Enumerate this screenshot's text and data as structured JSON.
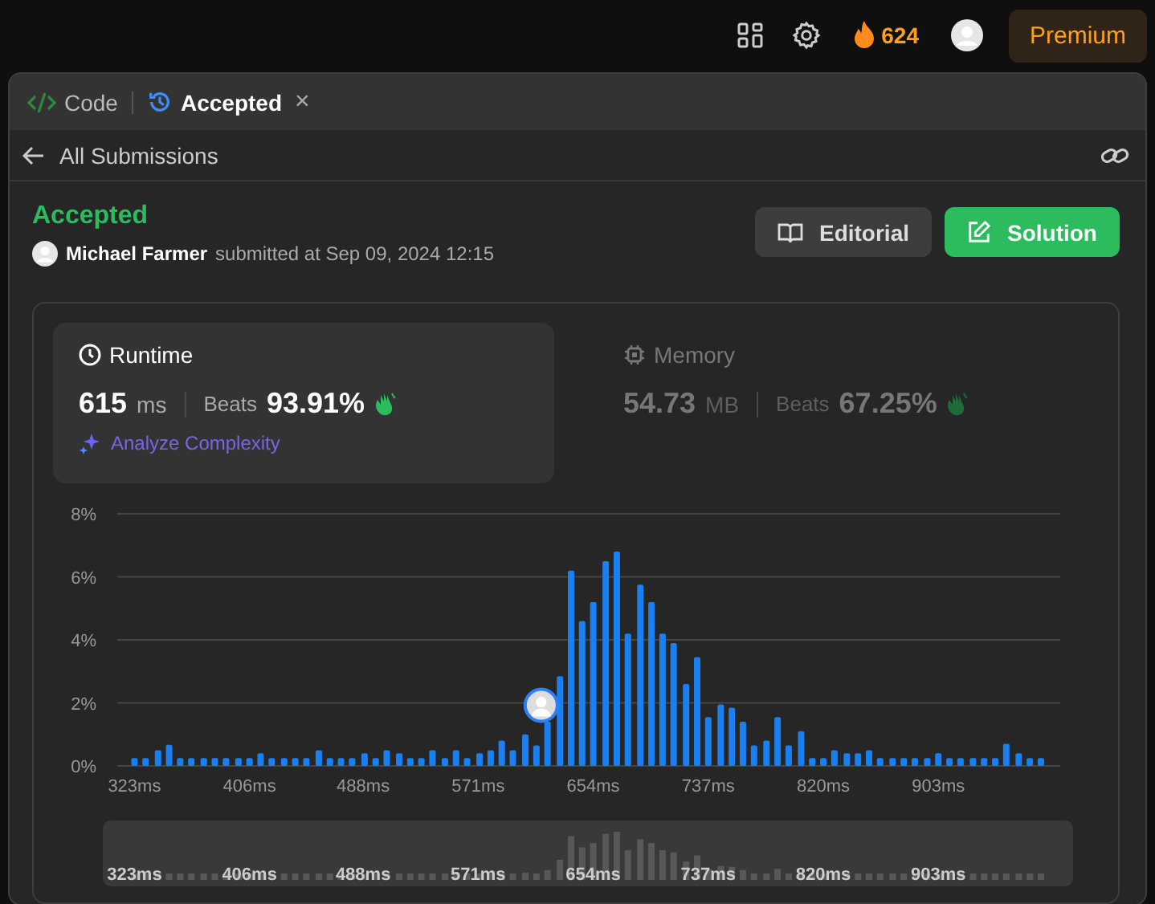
{
  "top_bar": {
    "streak": "624",
    "premium": "Premium"
  },
  "tabs": [
    {
      "label": "Code",
      "selected": false,
      "kind": "code"
    },
    {
      "label": "Accepted",
      "selected": true,
      "kind": "history",
      "close": "×"
    }
  ],
  "back_link": "All Submissions",
  "submission": {
    "status": "Accepted",
    "user": "Michael Farmer",
    "submitted": "submitted at Sep 09, 2024 12:15"
  },
  "buttons": [
    {
      "label": "Editorial",
      "kind": "editorial"
    },
    {
      "label": "Solution",
      "kind": "solution"
    }
  ],
  "metrics": [
    {
      "kind": "runtime",
      "title": "Runtime",
      "value": "615",
      "unit": "ms",
      "beats_label": "Beats",
      "beats": "93.91%",
      "selected": true,
      "action": "Analyze Complexity"
    },
    {
      "kind": "memory",
      "title": "Memory",
      "value": "54.73",
      "unit": "MB",
      "beats_label": "Beats",
      "beats": "67.25%",
      "selected": false
    }
  ],
  "chart": {
    "chart_data": {
      "type": "bar",
      "ylim": [
        0,
        8
      ],
      "xlim": [
        318,
        982
      ],
      "grid": true,
      "yticks": [
        {
          "value": 0,
          "label": "0%"
        },
        {
          "value": 2,
          "label": "2%"
        },
        {
          "value": 4,
          "label": "4%"
        },
        {
          "value": 6,
          "label": "6%"
        },
        {
          "value": 8,
          "label": "8%"
        }
      ],
      "xticks": [
        {
          "value": 323,
          "label": "323ms"
        },
        {
          "value": 406,
          "label": "406ms"
        },
        {
          "value": 488,
          "label": "488ms"
        },
        {
          "value": 571,
          "label": "571ms"
        },
        {
          "value": 654,
          "label": "654ms"
        },
        {
          "value": 737,
          "label": "737ms"
        },
        {
          "value": 820,
          "label": "820ms"
        },
        {
          "value": 903,
          "label": "903ms"
        }
      ],
      "x": [
        323,
        331,
        340,
        348,
        356,
        364,
        373,
        381,
        389,
        398,
        406,
        414,
        422,
        431,
        439,
        447,
        456,
        464,
        472,
        480,
        489,
        497,
        505,
        514,
        522,
        530,
        538,
        547,
        555,
        563,
        572,
        580,
        588,
        596,
        605,
        613,
        621,
        630,
        638,
        646,
        654,
        663,
        671,
        679,
        688,
        696,
        704,
        712,
        721,
        729,
        737,
        746,
        754,
        762,
        770,
        779,
        787,
        795,
        804,
        812,
        820,
        828,
        837,
        845,
        853,
        861,
        870,
        878,
        886,
        895,
        903,
        911,
        919,
        928,
        936,
        944,
        952,
        961,
        969,
        977
      ],
      "series": [
        {
          "color": "#1a7ff0",
          "values": [
            0.25,
            0.25,
            0.5,
            0.67,
            0.25,
            0.25,
            0.25,
            0.25,
            0.25,
            0.25,
            0.25,
            0.4,
            0.25,
            0.25,
            0.25,
            0.25,
            0.5,
            0.25,
            0.25,
            0.25,
            0.4,
            0.25,
            0.5,
            0.4,
            0.25,
            0.25,
            0.5,
            0.25,
            0.5,
            0.25,
            0.4,
            0.5,
            0.8,
            0.5,
            1.0,
            0.65,
            1.4,
            2.85,
            6.2,
            4.6,
            5.2,
            6.5,
            6.8,
            4.2,
            5.75,
            5.2,
            4.2,
            3.9,
            2.6,
            3.45,
            1.55,
            1.95,
            1.85,
            1.4,
            0.65,
            0.8,
            1.55,
            0.65,
            1.1,
            0.25,
            0.25,
            0.5,
            0.4,
            0.4,
            0.5,
            0.25,
            0.25,
            0.25,
            0.25,
            0.25,
            0.4,
            0.25,
            0.25,
            0.25,
            0.25,
            0.25,
            0.7,
            0.4,
            0.25,
            0.25
          ]
        }
      ],
      "orientation": "vertical"
    }
  },
  "navigator": {
    "labels": [
      "323ms",
      "406ms",
      "488ms",
      "571ms",
      "654ms",
      "737ms",
      "820ms",
      "903ms"
    ]
  }
}
